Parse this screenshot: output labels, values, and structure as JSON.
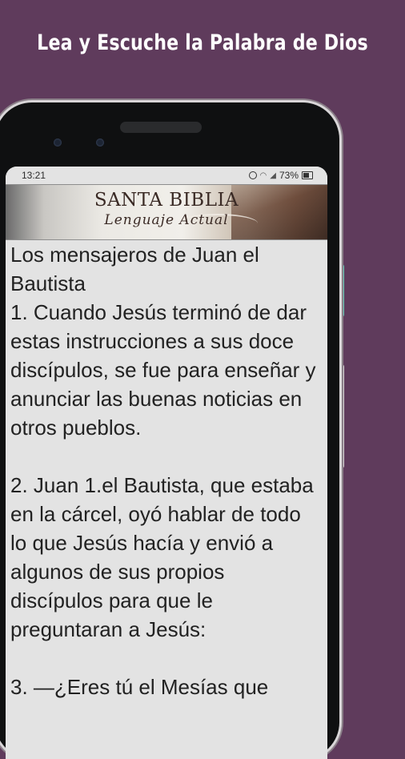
{
  "promo": {
    "title": "Lea y Escuche la Palabra de Dios"
  },
  "status_bar": {
    "time": "13:21",
    "battery": "73%"
  },
  "banner": {
    "title": "SANTA BIBLIA",
    "subtitle": "Lenguaje Actual"
  },
  "passage": {
    "heading": "Los mensajeros de Juan el Bautista",
    "verses": [
      "1. Cuando Jesús terminó de dar estas instrucciones a sus doce discípulos, se fue para enseñar y anunciar las buenas noticias en otros pueblos.",
      "2. Juan 1.el Bautista, que estaba en la cárcel, oyó hablar de todo lo que Jesús hacía y envió a algunos de sus propios discípulos para que le preguntaran a Jesús:",
      "3. —¿Eres tú el Mesías que"
    ]
  },
  "colors": {
    "background": "#5f3b5c",
    "screen": "#e3e3e3",
    "accent_button": "#5fc6b4"
  }
}
